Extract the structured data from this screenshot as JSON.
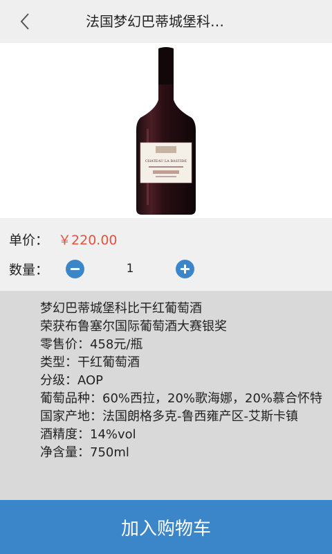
{
  "header": {
    "title": "法国梦幻巴蒂城堡科…",
    "back_icon": "chevron-left-icon"
  },
  "product": {
    "image": "wine-bottle-image",
    "label_text": "CHATEAU LA BASTIDE"
  },
  "price": {
    "label": "单价：",
    "value": "￥220.00",
    "color": "#e5523f"
  },
  "quantity": {
    "label": "数量：",
    "value": "1",
    "minus_icon": "minus-icon",
    "plus_icon": "plus-icon",
    "accent": "#3a86c8"
  },
  "details": {
    "lines": [
      "梦幻巴蒂城堡科比干红葡萄酒",
      "荣获布鲁塞尔国际葡萄酒大赛银奖",
      "零售价：458元/瓶",
      "类型：干红葡萄酒",
      "分级：AOP",
      "葡萄品种：60%西拉，20%歌海娜，20%慕合怀特",
      "国家产地：法国朗格多克-鲁西雍产区-艾斯卡镇",
      "酒精度：14%vol",
      "净含量：750ml"
    ]
  },
  "cart_button": {
    "label": "加入购物车",
    "color": "#3a86c8"
  }
}
